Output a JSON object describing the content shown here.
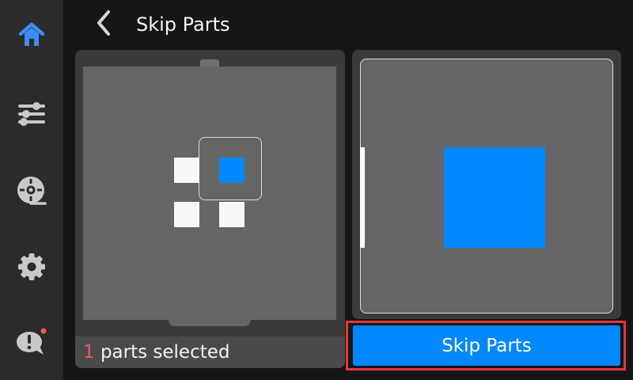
{
  "header": {
    "title": "Skip Parts"
  },
  "sidebar": {
    "items": [
      {
        "icon": "home-icon",
        "active": true
      },
      {
        "icon": "sliders-icon"
      },
      {
        "icon": "filament-spool-icon"
      },
      {
        "icon": "gear-icon"
      },
      {
        "icon": "alert-message-icon",
        "has_notification": true
      }
    ]
  },
  "plate": {
    "selected_count": "1",
    "selected_suffix": " parts selected",
    "parts": [
      {
        "id": 1,
        "selected": false
      },
      {
        "id": 2,
        "selected": true
      },
      {
        "id": 3,
        "selected": false
      },
      {
        "id": 4,
        "selected": false
      }
    ]
  },
  "actions": {
    "skip_label": "Skip Parts"
  },
  "colors": {
    "accent": "#0088ff",
    "sidebar_active": "#3d8df5",
    "count_text": "#f05a55",
    "highlight_outline": "#e0383b",
    "notification_dot": "#f05a55"
  }
}
